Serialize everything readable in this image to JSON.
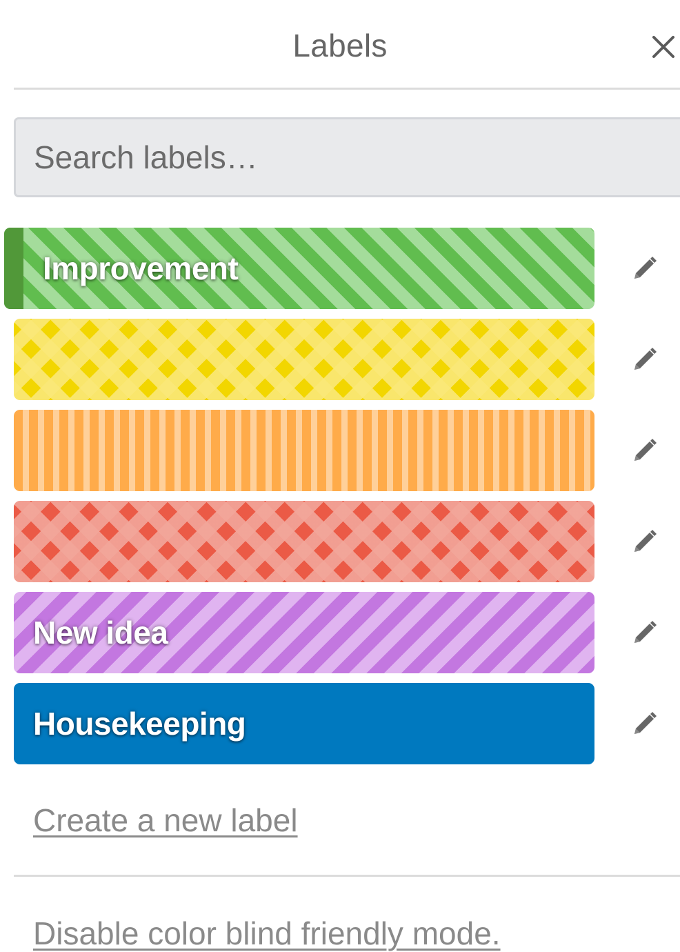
{
  "header": {
    "title": "Labels",
    "close_icon": "close-icon"
  },
  "search": {
    "placeholder": "Search labels…",
    "value": ""
  },
  "labels": [
    {
      "name": "Improvement",
      "color": "green",
      "pattern": "diagonal-stripes",
      "selected": true
    },
    {
      "name": "",
      "color": "yellow",
      "pattern": "diamonds",
      "selected": false
    },
    {
      "name": "",
      "color": "orange",
      "pattern": "vertical-stripes",
      "selected": false
    },
    {
      "name": "",
      "color": "red",
      "pattern": "diamonds",
      "selected": false
    },
    {
      "name": "New idea",
      "color": "purple",
      "pattern": "diagonal-stripes",
      "selected": false
    },
    {
      "name": "Housekeeping",
      "color": "blue",
      "pattern": "solid",
      "selected": false
    }
  ],
  "edit_icon": "pencil-icon",
  "footer": {
    "create_label": "Create a new label",
    "colorblind_toggle": "Disable color blind friendly mode."
  },
  "colors": {
    "green": "#61bd4f",
    "yellow": "#f2d600",
    "orange": "#ffab4a",
    "red": "#eb5a46",
    "purple": "#c377e0",
    "blue": "#0079bf",
    "selected_bar": "#519839"
  }
}
